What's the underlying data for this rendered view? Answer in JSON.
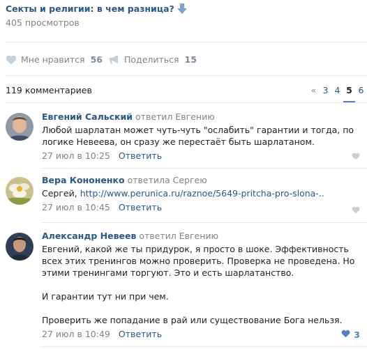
{
  "post": {
    "title": "Секты и религии: в чем разница?",
    "views": "405 просмотров"
  },
  "actions": {
    "like_label": "Мне нравится",
    "like_count": "56",
    "share_label": "Поделиться",
    "share_count": "15"
  },
  "comments_header": {
    "count_label": "119 комментариев"
  },
  "pager": {
    "prev": "«",
    "pages": [
      "3",
      "4",
      "5",
      "6"
    ],
    "active_page": "5"
  },
  "comments": [
    {
      "author": "Евгений Сальский",
      "reply_to": "ответил Евгению",
      "text": "Любой шарлатан может чуть-чуть \"ослабить\" гарантии и тогда, по логике Невеева, он сразу же перестаёт быть шарлатаном.",
      "date": "27 июл в 10:25",
      "reply_label": "Ответить",
      "likes": ""
    },
    {
      "author": "Вера Кононенко",
      "reply_to": "ответила Сергею",
      "text_prefix": "Сергей, ",
      "link": "http://www.perunica.ru/raznoe/5649-pritcha-pro-slona-..",
      "date": "27 июл в 10:45",
      "reply_label": "Ответить",
      "likes": ""
    },
    {
      "author": "Александр Невеев",
      "reply_to": "ответил Евгению",
      "paragraphs": [
        "Евгений, какой же ты придурок, я просто в шоке. Эффективность всех этих тренингов можно проверить. Проверка не проведена. Но этими тренингами торгуют. Это и есть шарлатанство.",
        "И гарантии тут ни при чем.",
        "Проверить же попадание в рай или существование Бога нельзя."
      ],
      "date": "27 июл в 10:49",
      "reply_label": "Ответить",
      "likes": "3"
    }
  ],
  "colors": {
    "link": "#2a5885",
    "muted": "#828282",
    "accent": "#5181b8",
    "divider": "#e7e8ec"
  },
  "icons": [
    "arrow-down-icon",
    "heart-icon",
    "megaphone-icon"
  ]
}
